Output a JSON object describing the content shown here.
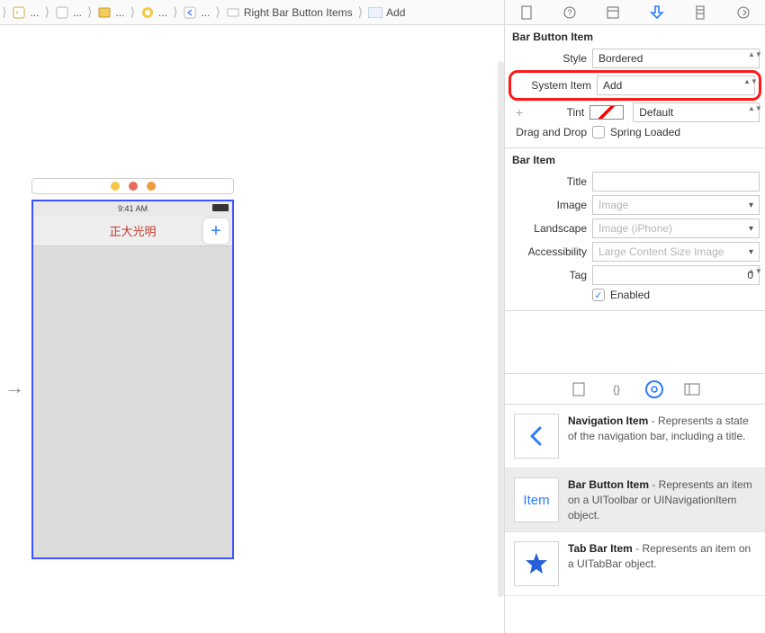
{
  "breadcrumb": {
    "items": [
      "...",
      "...",
      "...",
      "...",
      "Right Bar Button Items",
      "Add"
    ],
    "current_item_prefix": "Item"
  },
  "attributes_inspector": {
    "bar_button_item": {
      "header": "Bar Button Item",
      "style_label": "Style",
      "style_value": "Bordered",
      "system_item_label": "System Item",
      "system_item_value": "Add",
      "tint_label": "Tint",
      "tint_value": "Default",
      "drag_label": "Drag and Drop",
      "spring_loaded_label": "Spring Loaded"
    },
    "bar_item": {
      "header": "Bar Item",
      "title_label": "Title",
      "title_value": "",
      "image_label": "Image",
      "image_placeholder": "Image",
      "landscape_label": "Landscape",
      "landscape_placeholder": "Image (iPhone)",
      "accessibility_label": "Accessibility",
      "accessibility_placeholder": "Large Content Size Image",
      "tag_label": "Tag",
      "tag_value": "0",
      "enabled_label": "Enabled",
      "enabled_checked": true
    }
  },
  "canvas": {
    "status_time": "9:41 AM",
    "nav_title": "正大光明",
    "add_glyph": "+"
  },
  "library": {
    "items": [
      {
        "title": "Navigation Item",
        "desc": " - Represents a state of the navigation bar, including a title.",
        "icon": "chevron-left"
      },
      {
        "title": "Bar Button Item",
        "desc": " - Represents an item on a UIToolbar or UINavigationItem object.",
        "icon": "item-text"
      },
      {
        "title": "Tab Bar Item",
        "desc": " - Represents an item on a UITabBar object.",
        "icon": "star"
      }
    ],
    "icon_item_text": "Item"
  }
}
